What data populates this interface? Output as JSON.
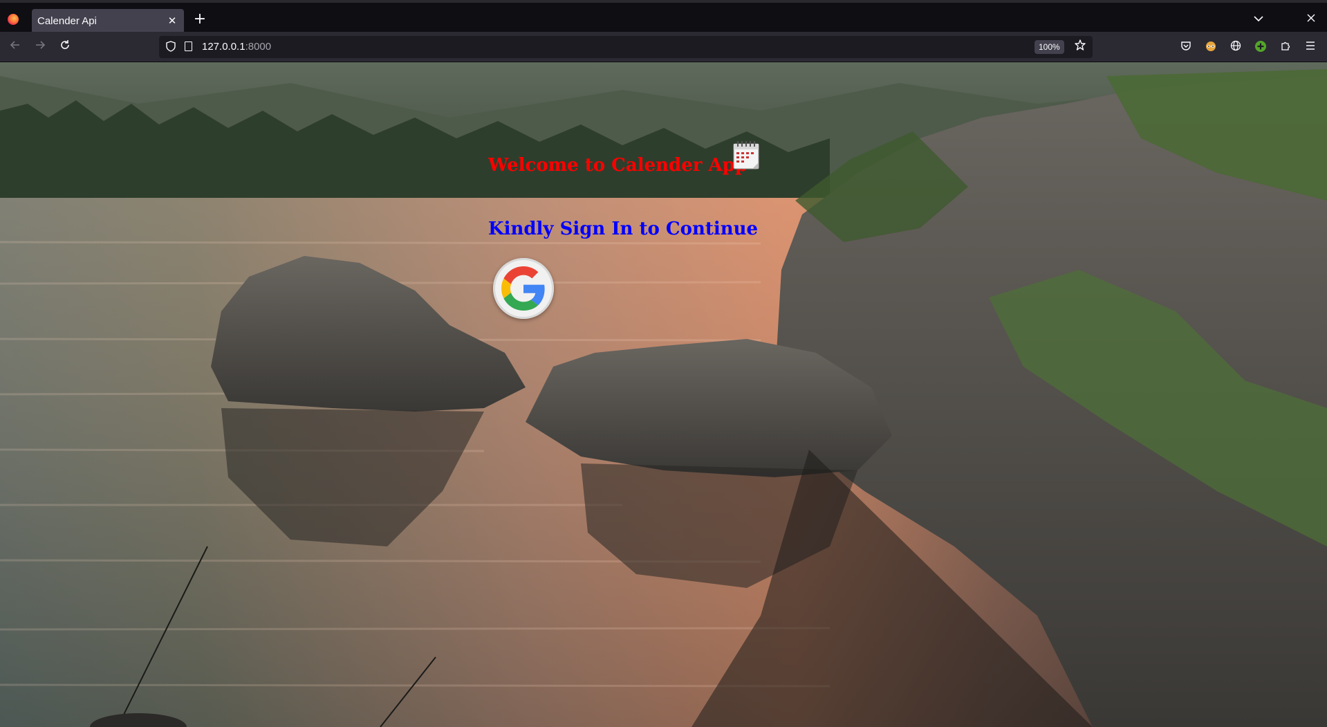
{
  "browser": {
    "tab_title": "Calender Api",
    "tab_close": "✕",
    "new_tab": "+",
    "url_host": "127.0.0.1",
    "url_port": ":8000",
    "zoom": "100%"
  },
  "page": {
    "welcome_text": "Welcome to Calender App",
    "signin_text": "Kindly Sign In to Continue"
  },
  "colors": {
    "welcome": "#ff0000",
    "signin": "#0000ff"
  }
}
